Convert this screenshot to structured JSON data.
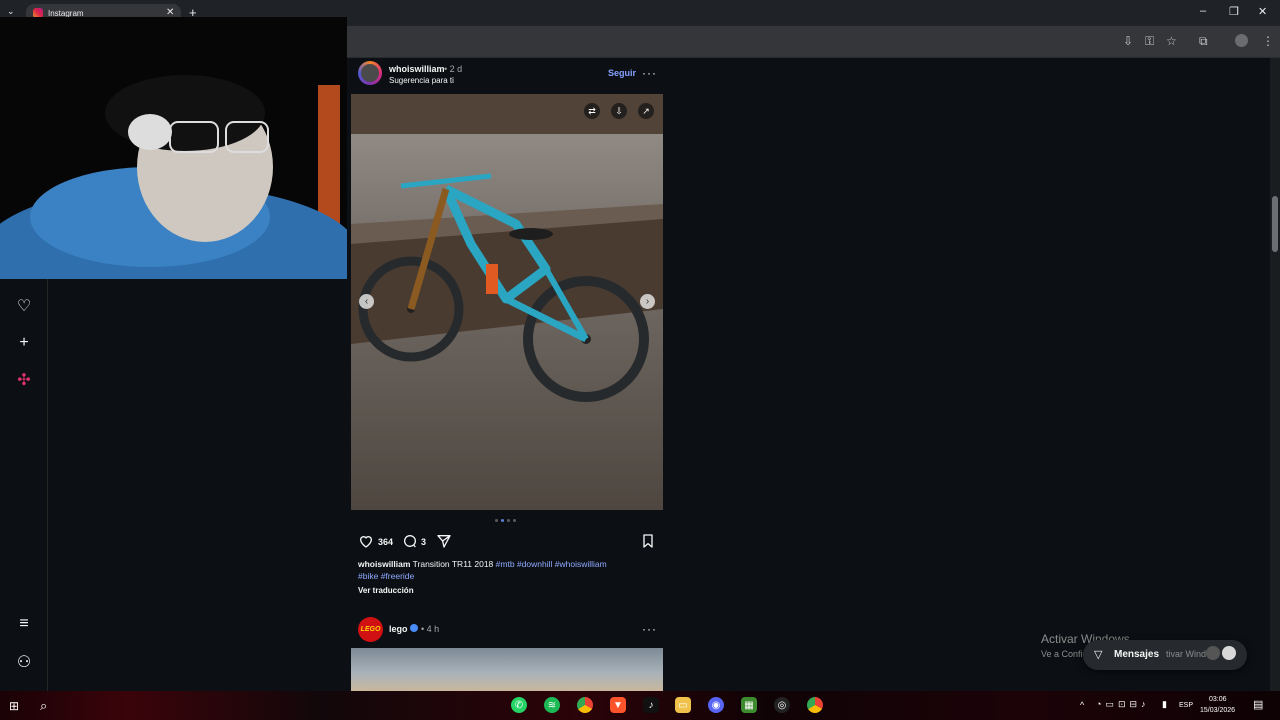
{
  "browser": {
    "tab_title": "Instagram",
    "new_tab": "+",
    "tab_close": "✕"
  },
  "post": {
    "author": "whoiswilliam",
    "time": "• 2 d",
    "subtitle": "Sugerencia para ti",
    "follow_label": "Seguir",
    "more": "···",
    "likes": "364",
    "comments": "3",
    "caption_author": "whoiswilliam",
    "caption_text": " Transition TR11 2018 ",
    "hashtags": [
      "#mtb",
      "#downhill",
      "#whoiswilliam",
      "#bike",
      "#freeride"
    ],
    "translate_label": "Ver traducción",
    "carousel_dots": 4,
    "active_dot": 1
  },
  "post2": {
    "author": "lego",
    "time": "• 4 h",
    "avatar_text": "LEGO",
    "more": "···"
  },
  "overlay": {
    "activate_title": "Activar Windows",
    "activate_sub": "Ve a Configu",
    "activate_sub2": "tivar Windo",
    "messages_label": "Mensajes"
  },
  "taskbar": {
    "time": "03:06",
    "date": "15/03/2026",
    "language": "ESP"
  },
  "colors": {
    "background": "#0c1014",
    "link": "#85a1ff",
    "hashtag": "#8fa9ff"
  }
}
